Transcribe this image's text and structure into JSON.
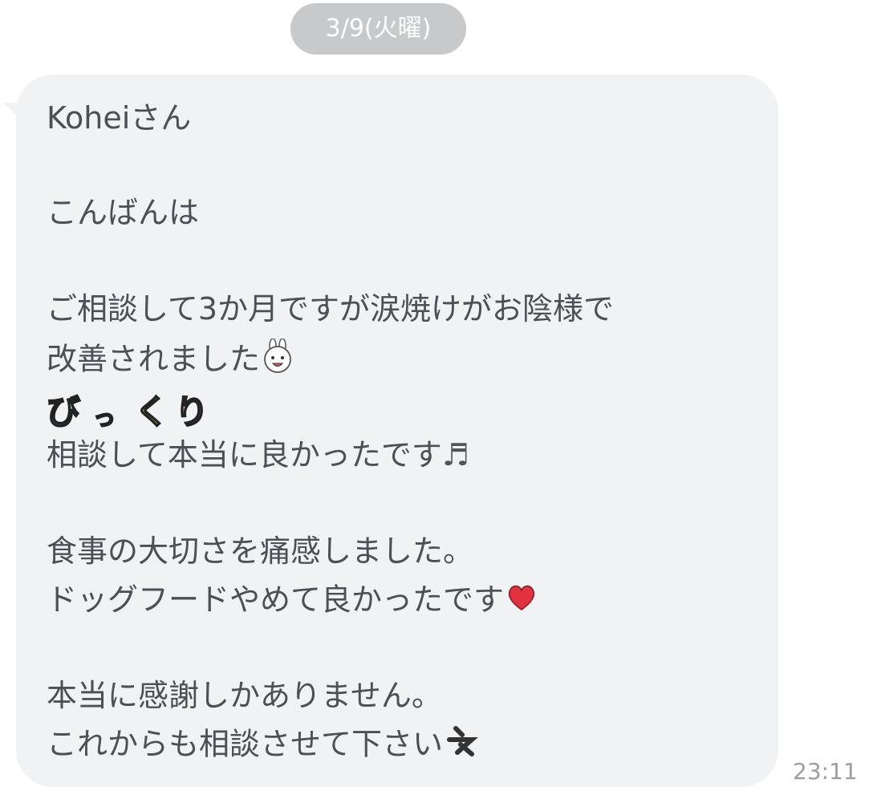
{
  "date_label": "3/9(火曜)",
  "message": {
    "lines": [
      "Koheiさん",
      "こんばんは",
      "ご相談して3か月ですが涙焼けがお陰様で",
      "改善されました",
      "相談して本当に良かったです",
      "食事の大切さを痛感しました。",
      "ドッグフードやめて良かったです",
      "本当に感謝しかありません。",
      "これからも相談させて下さい"
    ],
    "decorative_text": "びっくり",
    "music_note": "♬",
    "time": "23:11"
  },
  "colors": {
    "bubble": "#f1f2f4",
    "text": "#4b5056",
    "date_pill": "#c8c9ca",
    "time": "#9a9ea3",
    "heart": "#e2313f"
  },
  "emojis": [
    "rabbit-face-emoji",
    "music-note-emoji",
    "heart-emoji",
    "ne-sticker-emoji"
  ]
}
